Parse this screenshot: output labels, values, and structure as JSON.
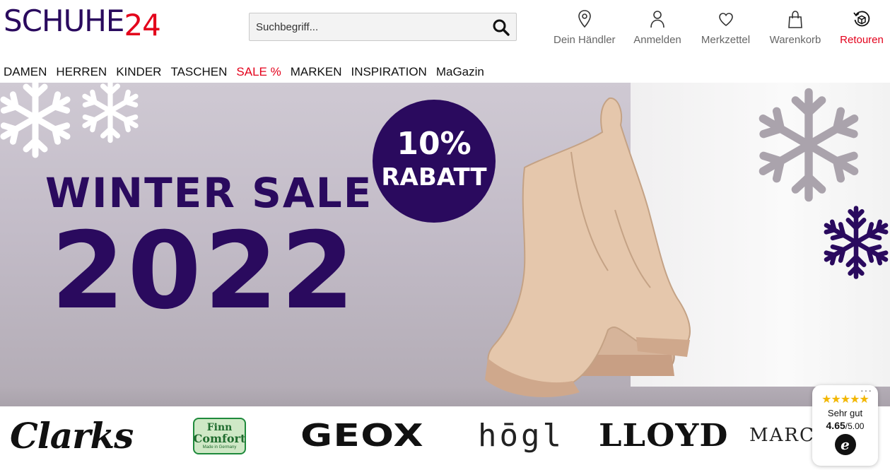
{
  "logo": {
    "part1": "SCHUHE",
    "part2": "24"
  },
  "search": {
    "placeholder": "Suchbegriff..."
  },
  "header_icons": [
    {
      "label": "Dein Händler",
      "icon": "location-pin-icon"
    },
    {
      "label": "Anmelden",
      "icon": "user-icon"
    },
    {
      "label": "Merkzettel",
      "icon": "heart-icon"
    },
    {
      "label": "Warenkorb",
      "icon": "shopping-bag-icon"
    },
    {
      "label": "Retouren",
      "icon": "return-box-icon"
    }
  ],
  "nav": [
    "DAMEN",
    "HERREN",
    "KINDER",
    "TASCHEN",
    "SALE %",
    "MARKEN",
    "INSPIRATION",
    "MaGazin"
  ],
  "hero": {
    "headline": "WINTER SALE",
    "year": "2022",
    "badge_percent": "10%",
    "badge_text": "RABATT"
  },
  "brands": [
    "Clarks",
    "Finn",
    "Comfort",
    "Made in Germany",
    "GEOX",
    "hōgl",
    "LLOYD",
    "MARCO"
  ],
  "trust_widget": {
    "stars": "★★★★★",
    "rating_text": "Sehr gut",
    "score": "4.65",
    "max": "/5.00",
    "logo_letter": "e"
  },
  "colors": {
    "brand_purple": "#2a0a5e",
    "brand_red": "#e3001b"
  }
}
